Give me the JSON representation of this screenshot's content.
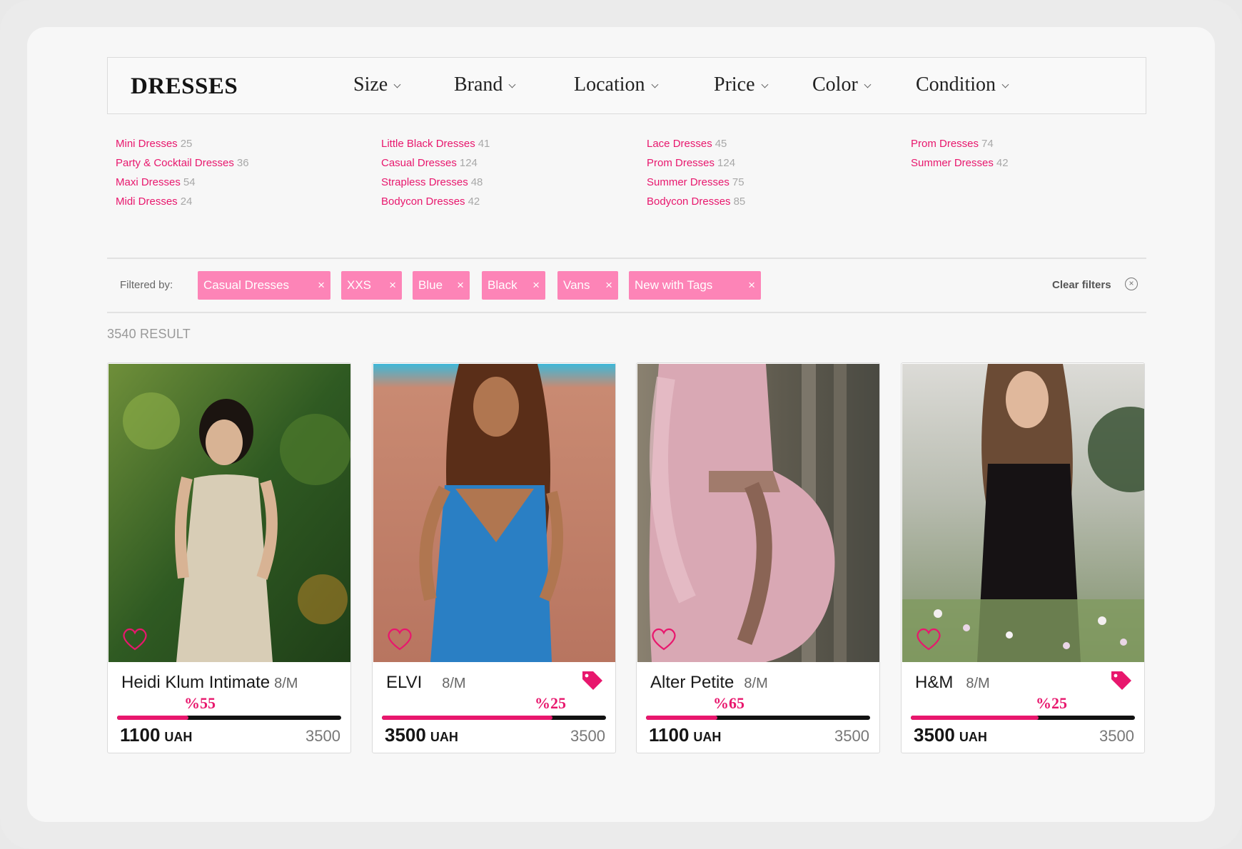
{
  "header": {
    "title": "DRESSES",
    "filters": [
      "Size",
      "Brand",
      "Location",
      "Price",
      "Color",
      "Condition"
    ]
  },
  "categories": [
    [
      {
        "label": "Mini Dresses",
        "count": "25"
      },
      {
        "label": "Party & Cocktail Dresses",
        "count": "36"
      },
      {
        "label": "Maxi Dresses",
        "count": "54"
      },
      {
        "label": "Midi Dresses",
        "count": "24"
      }
    ],
    [
      {
        "label": "Little Black Dresses",
        "count": "41"
      },
      {
        "label": "Casual Dresses",
        "count": "124"
      },
      {
        "label": "Strapless Dresses",
        "count": "48"
      },
      {
        "label": "Bodycon Dresses",
        "count": "42"
      }
    ],
    [
      {
        "label": "Lace Dresses",
        "count": "45"
      },
      {
        "label": "Prom Dresses",
        "count": "124"
      },
      {
        "label": "Summer Dresses",
        "count": "75"
      },
      {
        "label": "Bodycon Dresses",
        "count": "85"
      }
    ],
    [
      {
        "label": "Prom Dresses",
        "count": "74"
      },
      {
        "label": "Summer Dresses",
        "count": "42"
      }
    ]
  ],
  "filterbar": {
    "label": "Filtered by:",
    "chips": [
      "Casual Dresses",
      "XXS",
      "Blue",
      "Black",
      "Vans",
      "New with Tags"
    ],
    "remove_glyph": "×",
    "clear_label": "Clear filters"
  },
  "results": {
    "count_label": "3540 RESULT"
  },
  "colors": {
    "accent": "#e8176d",
    "chip": "#fd84b7"
  },
  "products": [
    {
      "brand": "Heidi Klum Intimate",
      "size": "8/M",
      "discount": "%55",
      "price": "1100",
      "currency": "UAH",
      "original": "3500",
      "tagged": false,
      "progress": 0.32,
      "image_hint": "woman in lace beige gown, green foliage"
    },
    {
      "brand": "ELVI",
      "size": "8/M",
      "discount": "%25",
      "price": "3500",
      "currency": "UAH",
      "original": "3500",
      "tagged": true,
      "progress": 0.76,
      "image_hint": "woman in blue dress, long hair"
    },
    {
      "brand": "Alter Petite",
      "size": "8/M",
      "discount": "%65",
      "price": "1100",
      "currency": "UAH",
      "original": "3500",
      "tagged": false,
      "progress": 0.32,
      "image_hint": "pregnant woman in pink lace dress"
    },
    {
      "brand": "H&M",
      "size": "8/M",
      "discount": "%25",
      "price": "3500",
      "currency": "UAH",
      "original": "3500",
      "tagged": true,
      "progress": 0.57,
      "image_hint": "woman in black dress in flower field"
    }
  ]
}
